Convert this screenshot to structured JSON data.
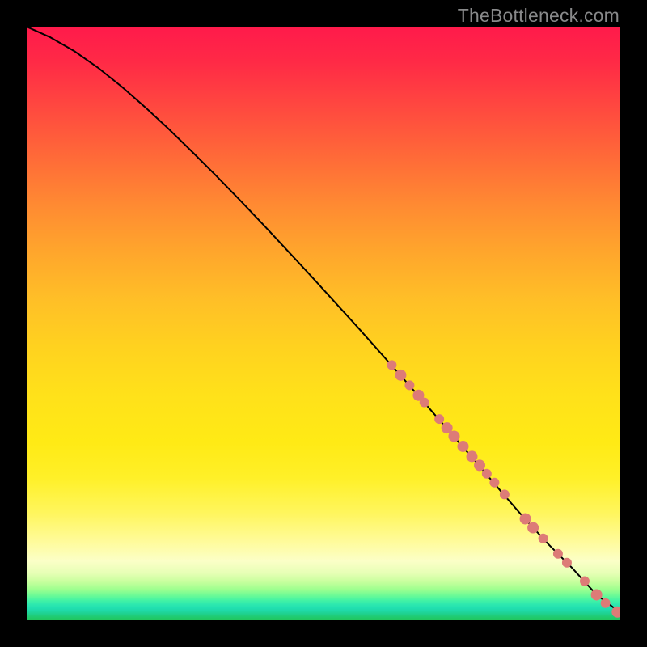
{
  "watermark": "TheBottleneck.com",
  "chart_data": {
    "type": "line",
    "title": "",
    "xlabel": "",
    "ylabel": "",
    "xlim": [
      0,
      100
    ],
    "ylim": [
      0,
      100
    ],
    "grid": false,
    "legend": null,
    "series": [
      {
        "name": "curve",
        "x": [
          0,
          4,
          8,
          12,
          16,
          20,
          24,
          28,
          32,
          36,
          40,
          44,
          48,
          52,
          56,
          60,
          64,
          68,
          72,
          76,
          80,
          84,
          88,
          92,
          96,
          100
        ],
        "y": [
          100,
          98.2,
          95.9,
          93.1,
          89.9,
          86.4,
          82.7,
          78.8,
          74.8,
          70.7,
          66.5,
          62.2,
          57.9,
          53.5,
          49.1,
          44.6,
          40.1,
          35.5,
          30.9,
          26.3,
          21.6,
          17.0,
          12.7,
          8.7,
          4.3,
          1.3
        ]
      }
    ],
    "scatter": [
      {
        "name": "points",
        "color": "#dd7b77",
        "items": [
          {
            "x": 61.5,
            "y": 43.0,
            "r": 6
          },
          {
            "x": 63.0,
            "y": 41.3,
            "r": 7
          },
          {
            "x": 64.5,
            "y": 39.6,
            "r": 6
          },
          {
            "x": 66.0,
            "y": 37.9,
            "r": 7
          },
          {
            "x": 67.0,
            "y": 36.7,
            "r": 6
          },
          {
            "x": 69.5,
            "y": 33.9,
            "r": 6
          },
          {
            "x": 70.8,
            "y": 32.4,
            "r": 7
          },
          {
            "x": 72.0,
            "y": 31.0,
            "r": 7
          },
          {
            "x": 73.5,
            "y": 29.3,
            "r": 7
          },
          {
            "x": 75.0,
            "y": 27.6,
            "r": 7
          },
          {
            "x": 76.3,
            "y": 26.1,
            "r": 7
          },
          {
            "x": 77.5,
            "y": 24.7,
            "r": 6
          },
          {
            "x": 78.8,
            "y": 23.2,
            "r": 6
          },
          {
            "x": 80.5,
            "y": 21.2,
            "r": 6
          },
          {
            "x": 84.0,
            "y": 17.1,
            "r": 7
          },
          {
            "x": 85.3,
            "y": 15.6,
            "r": 7
          },
          {
            "x": 87.0,
            "y": 13.8,
            "r": 6
          },
          {
            "x": 89.5,
            "y": 11.2,
            "r": 6
          },
          {
            "x": 91.0,
            "y": 9.7,
            "r": 6
          },
          {
            "x": 94.0,
            "y": 6.6,
            "r": 6
          },
          {
            "x": 96.0,
            "y": 4.3,
            "r": 7
          },
          {
            "x": 97.5,
            "y": 2.9,
            "r": 6
          },
          {
            "x": 99.5,
            "y": 1.4,
            "r": 7
          },
          {
            "x": 100.7,
            "y": 1.0,
            "r": 7
          }
        ]
      }
    ],
    "background": {
      "kind": "vertical-heat-gradient",
      "top_color": "#ff1a4b",
      "bottom_color": "#21c558"
    }
  }
}
